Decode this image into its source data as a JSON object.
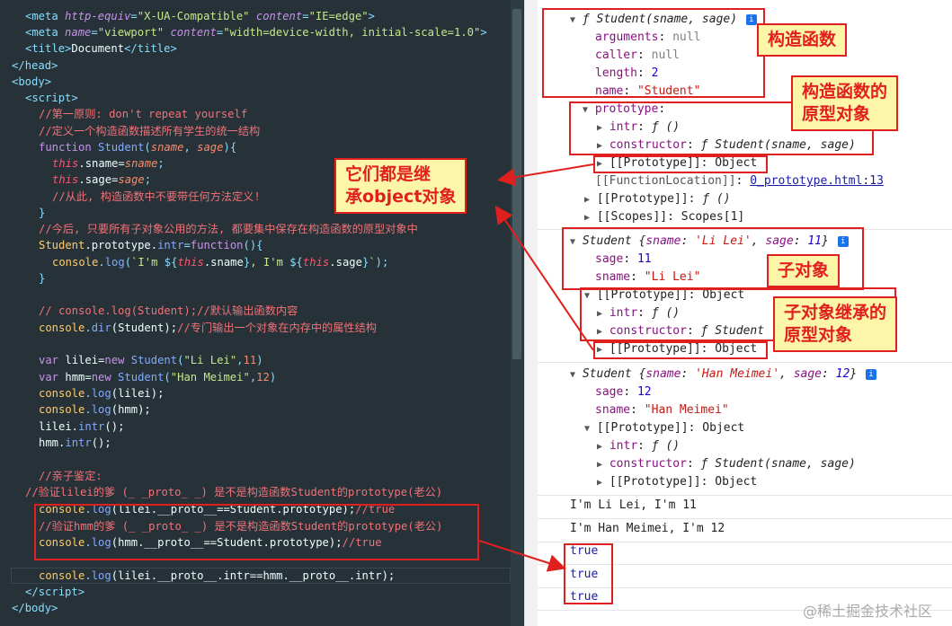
{
  "code": {
    "l0": {
      "a": "<",
      "b": "meta",
      "c": "http-equiv",
      "d": "=",
      "e": "\"X-UA-Compatible\"",
      "f": "content",
      "g": "=",
      "h": "\"IE=edge\"",
      "i": ">"
    },
    "l1": {
      "a": "<",
      "b": "meta",
      "c": "name",
      "d": "=",
      "e": "\"viewport\"",
      "f": "content",
      "g": "=",
      "h": "\"width=device-width, initial-scale=1.0\"",
      "i": ">"
    },
    "l2": {
      "a": "<",
      "b": "title",
      "c": ">",
      "d": "Document",
      "e": "</",
      "f": "title",
      "g": ">"
    },
    "l3": {
      "a": "</",
      "b": "head",
      "c": ">"
    },
    "l4": {
      "a": "<",
      "b": "body",
      "c": ">"
    },
    "l5": {
      "a": "<",
      "b": "script",
      "c": ">"
    },
    "l6": "//第一原则: don't repeat yourself",
    "l7": "//定义一个构造函数描述所有学生的统一结构",
    "l8": {
      "a": "function",
      "b": " Student",
      "c": "(",
      "d": "sname",
      "e": ", ",
      "f": "sage",
      "g": "){"
    },
    "l9": {
      "a": "this",
      "b": ".sname=",
      "c": "sname",
      "d": ";"
    },
    "l10": {
      "a": "this",
      "b": ".sage=",
      "c": "sage",
      "d": ";"
    },
    "l11": "//从此, 构造函数中不要带任何方法定义!",
    "l12": "}",
    "l13": "//今后, 只要所有子对象公用的方法, 都要集中保存在构造函数的原型对象中",
    "l14": {
      "a": "Student",
      "b": ".prototype.",
      "c": "intr",
      "d": "=",
      "e": "function",
      "f": "(){"
    },
    "l15": {
      "a": "console",
      "b": ".",
      "c": "log",
      "d": "(",
      "e": "`I'm ",
      "f": "${",
      "g": "this",
      "h": ".sname",
      "i": "}",
      "j": ", I'm ",
      "k": "${",
      "l": "this",
      "m": ".sage",
      "n": "}",
      "o": "`",
      "p": ");"
    },
    "l16": "}",
    "l18": "// console.log(Student);//默认输出函数内容",
    "l19": {
      "a": "console",
      "b": ".",
      "c": "dir",
      "d": "(Student);",
      "e": "//专门输出一个对象在内存中的属性结构"
    },
    "l21": {
      "a": "var",
      "b": " lilei=",
      "c": "new",
      "d": " Student",
      "e": "(",
      "f": "\"Li Lei\"",
      "g": ",",
      "h": "11",
      "i": ")"
    },
    "l22": {
      "a": "var",
      "b": " hmm=",
      "c": "new",
      "d": " Student",
      "e": "(",
      "f": "\"Han Meimei\"",
      "g": ",",
      "h": "12",
      "i": ")"
    },
    "l23": {
      "a": "console",
      "b": ".",
      "c": "log",
      "d": "(lilei);"
    },
    "l24": {
      "a": "console",
      "b": ".",
      "c": "log",
      "d": "(hmm);"
    },
    "l25": {
      "a": "lilei.",
      "b": "intr",
      "c": "();"
    },
    "l26": {
      "a": "hmm.",
      "b": "intr",
      "c": "();"
    },
    "l28": "//亲子鉴定:",
    "l29": "//验证lilei的爹 (_ _proto_ _) 是不是构造函数Student的prototype(老公)",
    "l30": {
      "a": "console",
      "b": ".",
      "c": "log",
      "d": "(lilei.__proto__==Student.prototype);",
      "e": "//true"
    },
    "l31": "//验证hmm的爹 (_ _proto_ _) 是不是构造函数Student的prototype(老公)",
    "l32": {
      "a": "console",
      "b": ".",
      "c": "log",
      "d": "(hmm.__proto__==Student.prototype);",
      "e": "//true"
    },
    "l34": {
      "a": "console",
      "b": ".",
      "c": "log",
      "d": "(lilei.__proto__.intr==hmm.__proto__.intr);"
    },
    "l35": {
      "a": "</",
      "b": "script",
      "c": ">"
    },
    "l36": {
      "a": "</",
      "b": "body",
      "c": ">"
    }
  },
  "console": {
    "c0": {
      "f": "ƒ",
      "sig": " Student(sname, sage)",
      "info": "i"
    },
    "c1": {
      "k": "arguments",
      "sep": ": ",
      "v": "null"
    },
    "c2": {
      "k": "caller",
      "sep": ": ",
      "v": "null"
    },
    "c3": {
      "k": "length",
      "sep": ": ",
      "v": "2"
    },
    "c4": {
      "k": "name",
      "sep": ": ",
      "v": "\"Student\""
    },
    "c5": {
      "k": "prototype",
      "sep": ":"
    },
    "c6": {
      "k": "intr",
      "sep": ": ",
      "f": "ƒ",
      "v": " ()"
    },
    "c7": {
      "k": "constructor",
      "sep": ": ",
      "f": "ƒ",
      "v": " Student(sname, sage)"
    },
    "c8": "[[Prototype]]: Object",
    "c9": {
      "k": "[[FunctionLocation]]",
      "sep": ": ",
      "link": "0_prototype.html:13"
    },
    "c10": {
      "k": "[[Prototype]]",
      "sep": ": ",
      "f": "ƒ",
      "v": " ()"
    },
    "c11": "[[Scopes]]: Scopes[1]",
    "c12": {
      "name": "Student",
      "open": " {",
      "k1": "sname",
      "s1": ": ",
      "v1": "'Li Lei'",
      "c": ", ",
      "k2": "sage",
      "s2": ": ",
      "v2": "11",
      "close": "}",
      "info": "i"
    },
    "c13": {
      "k": "sage",
      "sep": ": ",
      "v": "11"
    },
    "c14": {
      "k": "sname",
      "sep": ": ",
      "v": "\"Li Lei\""
    },
    "c15": "[[Prototype]]: Object",
    "c16": {
      "k": "intr",
      "sep": ": ",
      "f": "ƒ",
      "v": " ()"
    },
    "c17": {
      "k": "constructor",
      "sep": ": ",
      "f": "ƒ",
      "v": " Student"
    },
    "c18": "[[Prototype]]: Object",
    "c19": {
      "name": "Student",
      "open": " {",
      "k1": "sname",
      "s1": ": ",
      "v1": "'Han Meimei'",
      "c": ", ",
      "k2": "sage",
      "s2": ": ",
      "v2": "12",
      "close": "}",
      "info": "i"
    },
    "c20": {
      "k": "sage",
      "sep": ": ",
      "v": "12"
    },
    "c21": {
      "k": "sname",
      "sep": ": ",
      "v": "\"Han Meimei\""
    },
    "c22": "[[Prototype]]: Object",
    "c23": {
      "k": "intr",
      "sep": ": ",
      "f": "ƒ",
      "v": " ()"
    },
    "c24": {
      "k": "constructor",
      "sep": ": ",
      "f": "ƒ",
      "v": " Student(sname, sage)"
    },
    "c25": "[[Prototype]]: Object",
    "out1": "I'm Li Lei, I'm 11",
    "out2": "I'm Han Meimei, I'm 12",
    "t1": "true",
    "t2": "true",
    "t3": "true"
  },
  "annotations": {
    "constructor_fn": "构造函数",
    "prototype_obj_1": "构造函数的",
    "prototype_obj_2": "原型对象",
    "inherit_1": "它们都是继",
    "inherit_2": "承object对象",
    "child_obj": "子对象",
    "child_proto_1": "子对象继承的",
    "child_proto_2": "原型对象"
  },
  "watermark": "@稀土掘金技术社区",
  "colors": {
    "annotation_red": "#e0201f",
    "annotation_bg": "#fdf6a8",
    "editor_bg": "#263238"
  }
}
